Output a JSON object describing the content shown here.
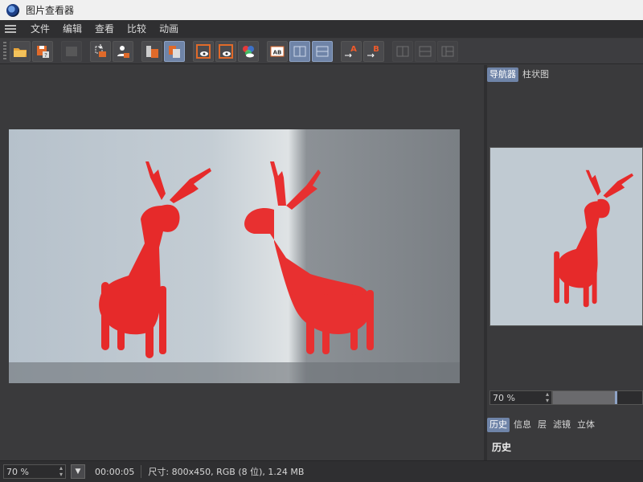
{
  "window": {
    "title": "图片查看器"
  },
  "menu": {
    "items": [
      "文件",
      "编辑",
      "查看",
      "比较",
      "动画"
    ]
  },
  "toolbar": {
    "buttons": [
      {
        "name": "open-file-button",
        "icon": "open-folder-icon"
      },
      {
        "name": "save-button",
        "icon": "save-icon"
      },
      {
        "name": "render-button",
        "icon": "render-icon",
        "disabled": true
      },
      {
        "name": "export-button",
        "icon": "export-icon"
      },
      {
        "name": "import-button",
        "icon": "import-icon"
      },
      {
        "name": "delete-button",
        "icon": "delete-icon"
      },
      {
        "name": "copy-button",
        "icon": "copy-icon",
        "active": true
      },
      {
        "name": "view-a-button",
        "icon": "eye-icon"
      },
      {
        "name": "view-b-button",
        "icon": "eye-icon"
      },
      {
        "name": "view-compare-button",
        "icon": "color-compare-icon"
      },
      {
        "name": "compare-ab-button",
        "label": "AB",
        "icon": "ab-icon"
      },
      {
        "name": "split-left-button",
        "icon": "split-icon",
        "active": true
      },
      {
        "name": "split-right-button",
        "icon": "split-icon",
        "active": true
      },
      {
        "name": "set-a-button",
        "label": "A",
        "icon": "arrow-a-icon"
      },
      {
        "name": "set-b-button",
        "label": "B",
        "icon": "arrow-b-icon"
      },
      {
        "name": "layout-1-button",
        "icon": "layout-icon",
        "disabled": true
      },
      {
        "name": "layout-2-button",
        "icon": "layout-icon",
        "disabled": true
      },
      {
        "name": "layout-3-button",
        "icon": "layout-icon",
        "disabled": true
      }
    ]
  },
  "navigator": {
    "tabs": [
      {
        "label": "导航器",
        "active": true
      },
      {
        "label": "柱状图",
        "active": false
      }
    ],
    "zoom_value": "70 %",
    "zoom_slider_fraction": 0.7
  },
  "bottom_panel": {
    "tabs": [
      {
        "label": "历史",
        "active": true
      },
      {
        "label": "信息",
        "active": false
      },
      {
        "label": "层",
        "active": false
      },
      {
        "label": "滤镜",
        "active": false
      },
      {
        "label": "立体",
        "active": false
      }
    ],
    "heading": "历史"
  },
  "status": {
    "zoom_value": "70 %",
    "time": "00:00:05",
    "info": "尺寸: 800x450, RGB (8 位), 1.24 MB"
  },
  "colors": {
    "accent": "#6f84a8",
    "background": "#3a3a3c",
    "deer_red": "#e62a2a"
  }
}
